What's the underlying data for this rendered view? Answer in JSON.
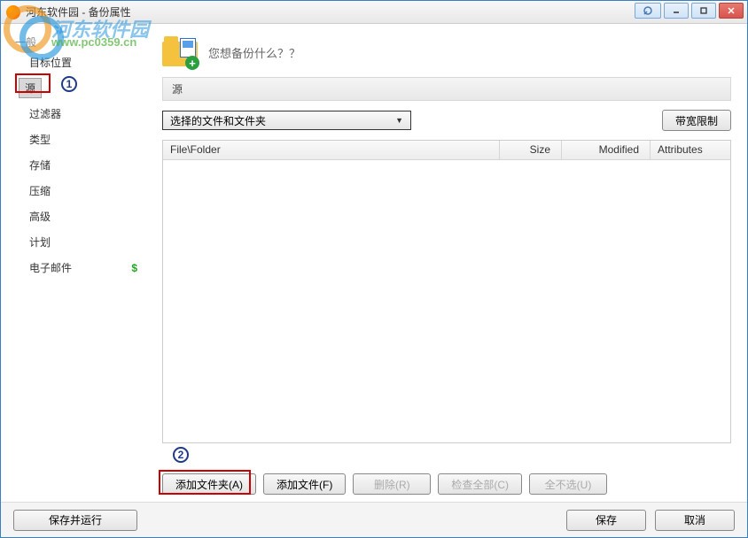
{
  "titlebar": {
    "title": "河东软件园 - 备份属性"
  },
  "watermark": {
    "brand": "河东软件园",
    "url": "www.pc0359.cn"
  },
  "sidebar": {
    "header": "一般",
    "items": [
      {
        "label": "目标位置"
      },
      {
        "label": "源",
        "selected": true,
        "annot": "1"
      },
      {
        "label": "过滤器"
      },
      {
        "label": "类型"
      },
      {
        "label": "存储",
        "indent": true
      },
      {
        "label": "压缩"
      },
      {
        "label": "高级"
      },
      {
        "label": "计划"
      },
      {
        "label": "电子邮件",
        "icon": "$"
      }
    ]
  },
  "main": {
    "heading": "您想备份什么？？",
    "section_label": "源",
    "select_label": "选择的文件和文件夹",
    "bandwidth_btn": "带宽限制",
    "table": {
      "columns": {
        "file": "File\\Folder",
        "size": "Size",
        "modified": "Modified",
        "attributes": "Attributes"
      }
    },
    "annot2": "2",
    "actions": {
      "add_folder": "添加文件夹(A)",
      "add_file": "添加文件(F)",
      "delete": "删除(R)",
      "check_all": "检查全部(C)",
      "uncheck_all": "全不选(U)"
    }
  },
  "footer": {
    "save_run": "保存并运行",
    "save": "保存",
    "cancel": "取消"
  }
}
